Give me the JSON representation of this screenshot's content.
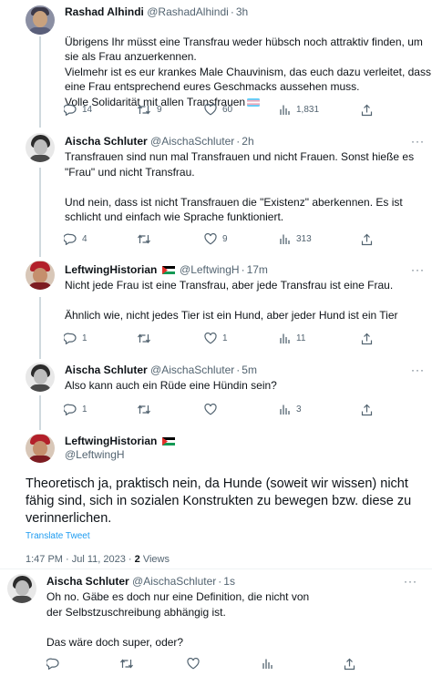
{
  "tweets": [
    {
      "name": "Rashad Alhindi",
      "handle": "@RashadAlhindi",
      "time": "3h",
      "text": "Übrigens Ihr müsst eine Transfrau weder hübsch noch attraktiv finden, um sie als Frau anzuerkennen.\nVielmehr ist es eur krankes Male Chauvinism, das euch dazu verleitet, dass eine Frau entsprechend eures Geschmacks aussehen muss.\nVolle Solidarität mit allen Transfrauen",
      "flag_icon": "transgender-flag-icon",
      "replies": "14",
      "retweets": "9",
      "likes": "60",
      "views": "1,831"
    },
    {
      "name": "Aischa Schluter",
      "handle": "@AischaSchluter",
      "time": "2h",
      "text": "Transfrauen sind nun mal Transfrauen und nicht Frauen. Sonst hieße es \"Frau\" und nicht Transfrau.\n\nUnd nein, dass ist nicht Transfrauen die \"Existenz\" aberkennen. Es ist schlicht und einfach wie Sprache funktioniert.",
      "replies": "4",
      "retweets": "",
      "likes": "9",
      "views": "313"
    },
    {
      "name": "LeftwingHistorian",
      "handle": "@LeftwingH",
      "time": "17m",
      "text": "Nicht jede Frau ist eine Transfrau, aber jede Transfrau ist eine Frau.\n\nÄhnlich wie, nicht jedes Tier ist ein Hund, aber jeder Hund ist ein Tier",
      "replies": "1",
      "retweets": "",
      "likes": "1",
      "views": "11"
    },
    {
      "name": "Aischa Schluter",
      "handle": "@AischaSchluter",
      "time": "5m",
      "text": "Also kann auch ein Rüde eine Hündin sein?",
      "replies": "1",
      "retweets": "",
      "likes": "",
      "views": "3"
    }
  ],
  "focus": {
    "name": "LeftwingHistorian",
    "handle": "@LeftwingH",
    "text": "Theoretisch ja, praktisch nein, da Hunde (soweit wir wissen) nicht fähig sind, sich in sozialen Konstrukten zu bewegen bzw. diese zu verinnerlichen.",
    "translate": "Translate Tweet",
    "timestamp": "1:47 PM · Jul 11, 2023 ·",
    "views_count": "2",
    "views_label": "Views"
  },
  "reply": {
    "name": "Aischa Schluter",
    "handle": "@AischaSchluter",
    "time": "1s",
    "text": "Oh no. Gäbe es doch nur eine Definition, die nicht von der Selbstzuschreibung abhängig ist.\n\nDas wäre doch super, oder?"
  },
  "separator": "·",
  "more_label": "···",
  "colors": {
    "text": "#0f1419",
    "muted": "#536471",
    "link": "#1d9bf0",
    "line": "#cfd9de"
  }
}
